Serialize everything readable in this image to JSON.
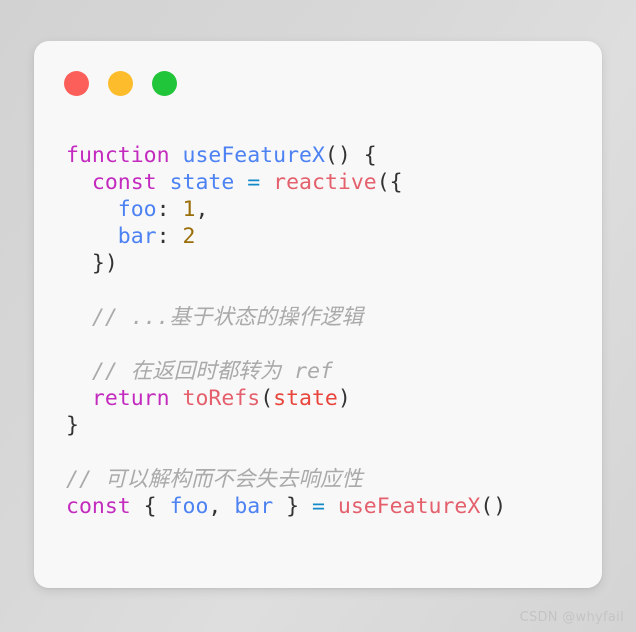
{
  "window": {
    "controls": [
      {
        "name": "close",
        "color": "#fc5f5a"
      },
      {
        "name": "minimize",
        "color": "#fcbc2c"
      },
      {
        "name": "maximize",
        "color": "#20c53a"
      }
    ]
  },
  "theme": {
    "page_background": "#d8d8d8",
    "card_background": "#f8f8f8",
    "keyword": "#c32bbf",
    "identifier": "#4d82f3",
    "function_call": "#e4606d",
    "argument": "#e8453c",
    "number": "#9a6e08",
    "operator": "#1389c8",
    "punctuation": "#333333",
    "comment": "#aaaaaa"
  },
  "code": {
    "language": "javascript",
    "lines": [
      {
        "id": 1,
        "text": "function useFeatureX() {",
        "tokens": [
          {
            "t": "function",
            "c": "kw"
          },
          {
            "t": " ",
            "c": "punc"
          },
          {
            "t": "useFeatureX",
            "c": "fn"
          },
          {
            "t": "() {",
            "c": "punc"
          }
        ]
      },
      {
        "id": 2,
        "text": "  const state = reactive({",
        "tokens": [
          {
            "t": "  ",
            "c": "punc"
          },
          {
            "t": "const",
            "c": "kw"
          },
          {
            "t": " ",
            "c": "punc"
          },
          {
            "t": "state",
            "c": "var"
          },
          {
            "t": " ",
            "c": "punc"
          },
          {
            "t": "=",
            "c": "op"
          },
          {
            "t": " ",
            "c": "punc"
          },
          {
            "t": "reactive",
            "c": "call"
          },
          {
            "t": "({",
            "c": "punc"
          }
        ]
      },
      {
        "id": 3,
        "text": "    foo: 1,",
        "tokens": [
          {
            "t": "    ",
            "c": "punc"
          },
          {
            "t": "foo",
            "c": "var"
          },
          {
            "t": ": ",
            "c": "punc"
          },
          {
            "t": "1",
            "c": "num"
          },
          {
            "t": ",",
            "c": "punc"
          }
        ]
      },
      {
        "id": 4,
        "text": "    bar: 2",
        "tokens": [
          {
            "t": "    ",
            "c": "punc"
          },
          {
            "t": "bar",
            "c": "var"
          },
          {
            "t": ": ",
            "c": "punc"
          },
          {
            "t": "2",
            "c": "num"
          }
        ]
      },
      {
        "id": 5,
        "text": "  })",
        "tokens": [
          {
            "t": "  })",
            "c": "punc"
          }
        ]
      },
      {
        "id": 6,
        "text": "",
        "tokens": []
      },
      {
        "id": 7,
        "text": "  // ...基于状态的操作逻辑",
        "tokens": [
          {
            "t": "  ",
            "c": "punc"
          },
          {
            "t": "// ...基于状态的操作逻辑",
            "c": "cmt"
          }
        ]
      },
      {
        "id": 8,
        "text": "",
        "tokens": []
      },
      {
        "id": 9,
        "text": "  // 在返回时都转为 ref",
        "tokens": [
          {
            "t": "  ",
            "c": "punc"
          },
          {
            "t": "// 在返回时都转为 ref",
            "c": "cmt"
          }
        ]
      },
      {
        "id": 10,
        "text": "  return toRefs(state)",
        "tokens": [
          {
            "t": "  ",
            "c": "punc"
          },
          {
            "t": "return",
            "c": "kw"
          },
          {
            "t": " ",
            "c": "punc"
          },
          {
            "t": "toRefs",
            "c": "call"
          },
          {
            "t": "(",
            "c": "punc"
          },
          {
            "t": "state",
            "c": "arg"
          },
          {
            "t": ")",
            "c": "punc"
          }
        ]
      },
      {
        "id": 11,
        "text": "}",
        "tokens": [
          {
            "t": "}",
            "c": "punc"
          }
        ]
      },
      {
        "id": 12,
        "text": "",
        "tokens": []
      },
      {
        "id": 13,
        "text": "// 可以解构而不会失去响应性",
        "tokens": [
          {
            "t": "// 可以解构而不会失去响应性",
            "c": "cmt"
          }
        ]
      },
      {
        "id": 14,
        "text": "const { foo, bar } = useFeatureX()",
        "tokens": [
          {
            "t": "const",
            "c": "kw"
          },
          {
            "t": " { ",
            "c": "punc"
          },
          {
            "t": "foo",
            "c": "var"
          },
          {
            "t": ", ",
            "c": "punc"
          },
          {
            "t": "bar",
            "c": "var"
          },
          {
            "t": " } ",
            "c": "punc"
          },
          {
            "t": "=",
            "c": "op"
          },
          {
            "t": " ",
            "c": "punc"
          },
          {
            "t": "useFeatureX",
            "c": "call"
          },
          {
            "t": "()",
            "c": "punc"
          }
        ]
      }
    ]
  },
  "watermark": {
    "text": "CSDN @whyfail"
  }
}
